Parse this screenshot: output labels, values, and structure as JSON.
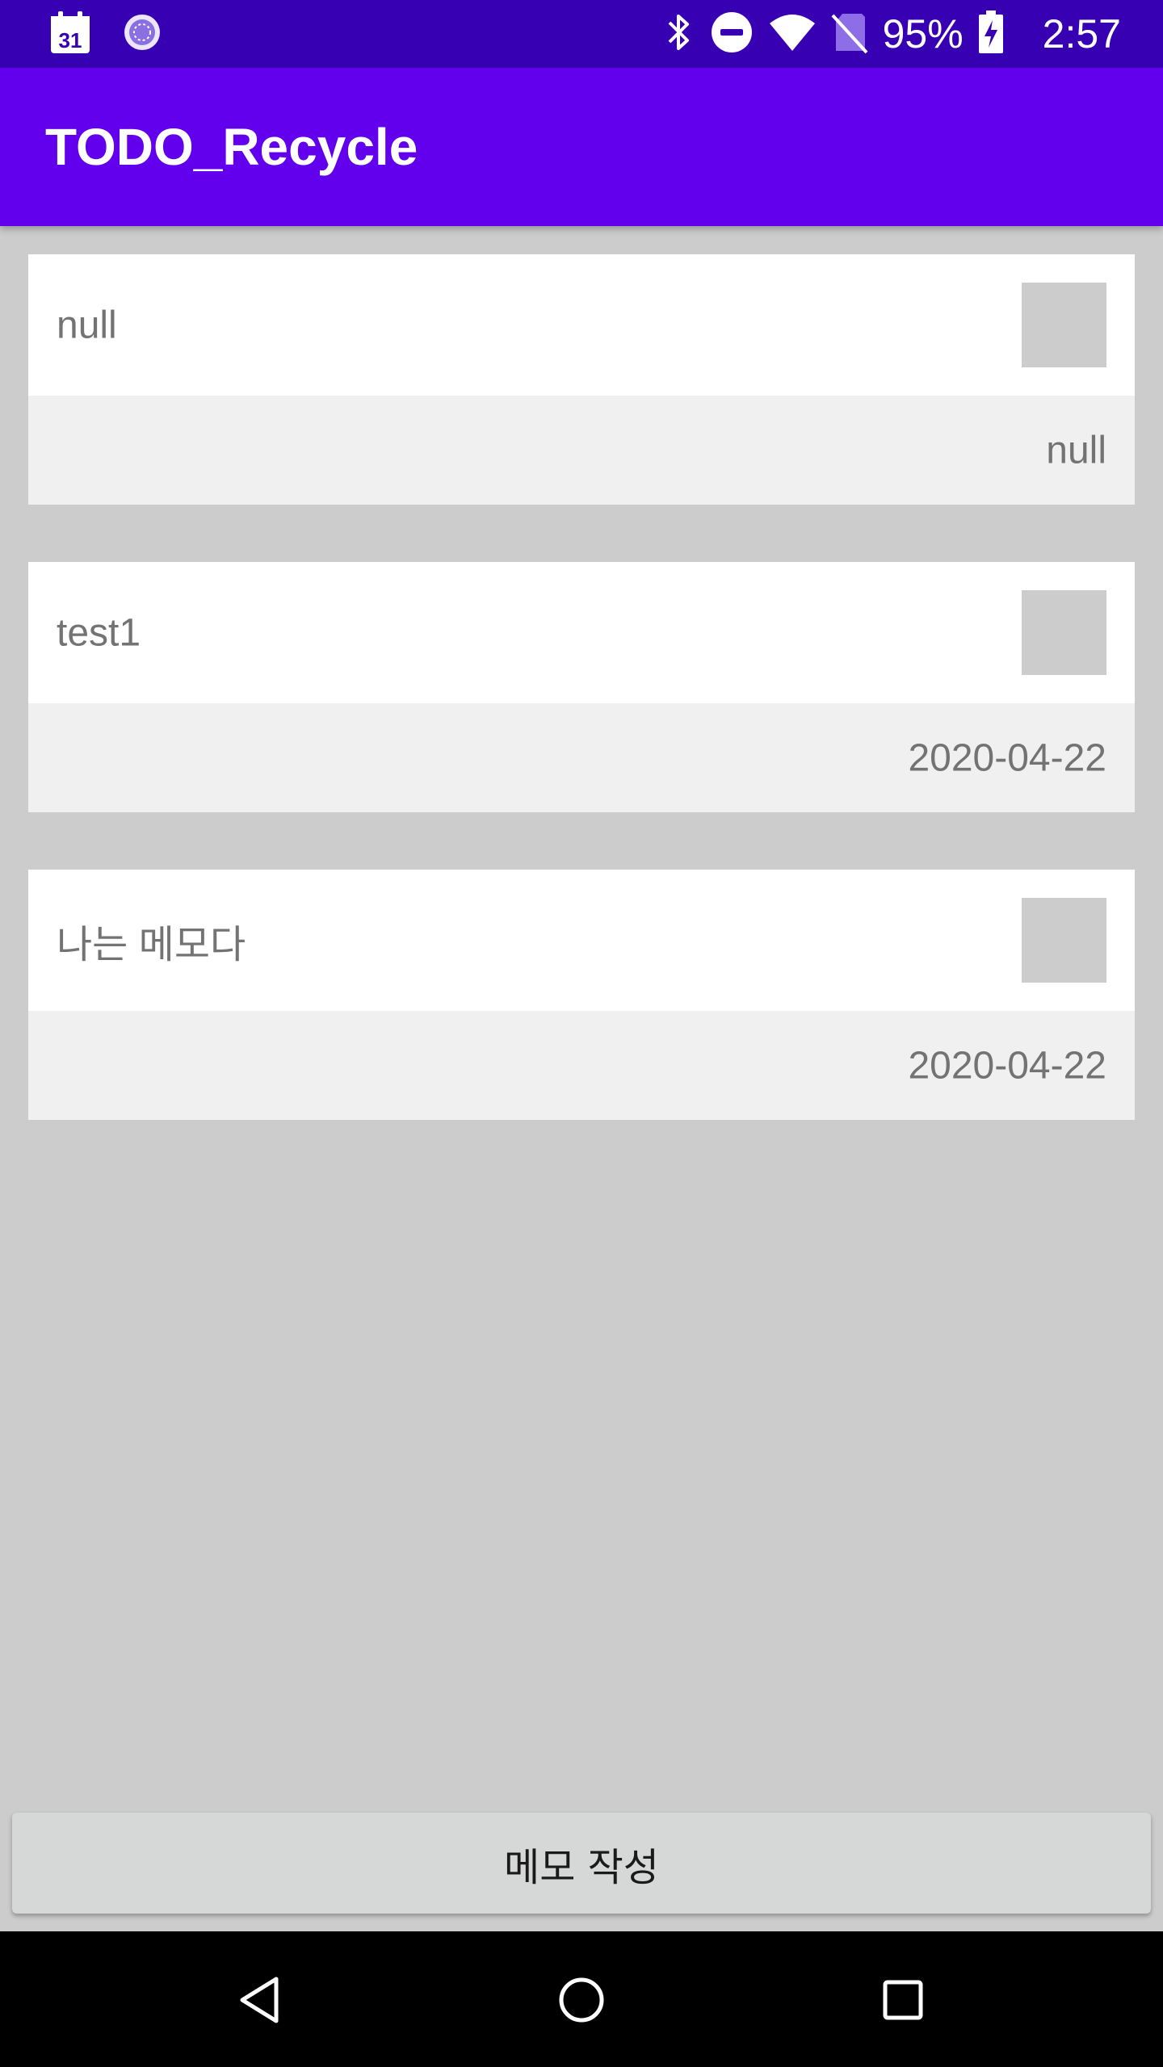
{
  "status_bar": {
    "calendar_day": "31",
    "battery_percent": "95%",
    "time": "2:57",
    "icons": [
      "calendar-icon",
      "sync-icon",
      "bluetooth-icon",
      "do-not-disturb-icon",
      "wifi-icon",
      "no-sim-icon",
      "battery-charging-icon"
    ]
  },
  "app_bar": {
    "title": "TODO_Recycle"
  },
  "memos": [
    {
      "text": "null",
      "date": "null"
    },
    {
      "text": "test1",
      "date": "2020-04-22"
    },
    {
      "text": "나는 메모다",
      "date": "2020-04-22"
    }
  ],
  "write_button": {
    "label": "메모 작성"
  },
  "nav_bar": {
    "icons": [
      "back-icon",
      "home-icon",
      "recents-icon"
    ]
  },
  "colors": {
    "status_bar": "#3700b3",
    "app_bar": "#6200ee",
    "background": "#cccccc"
  }
}
